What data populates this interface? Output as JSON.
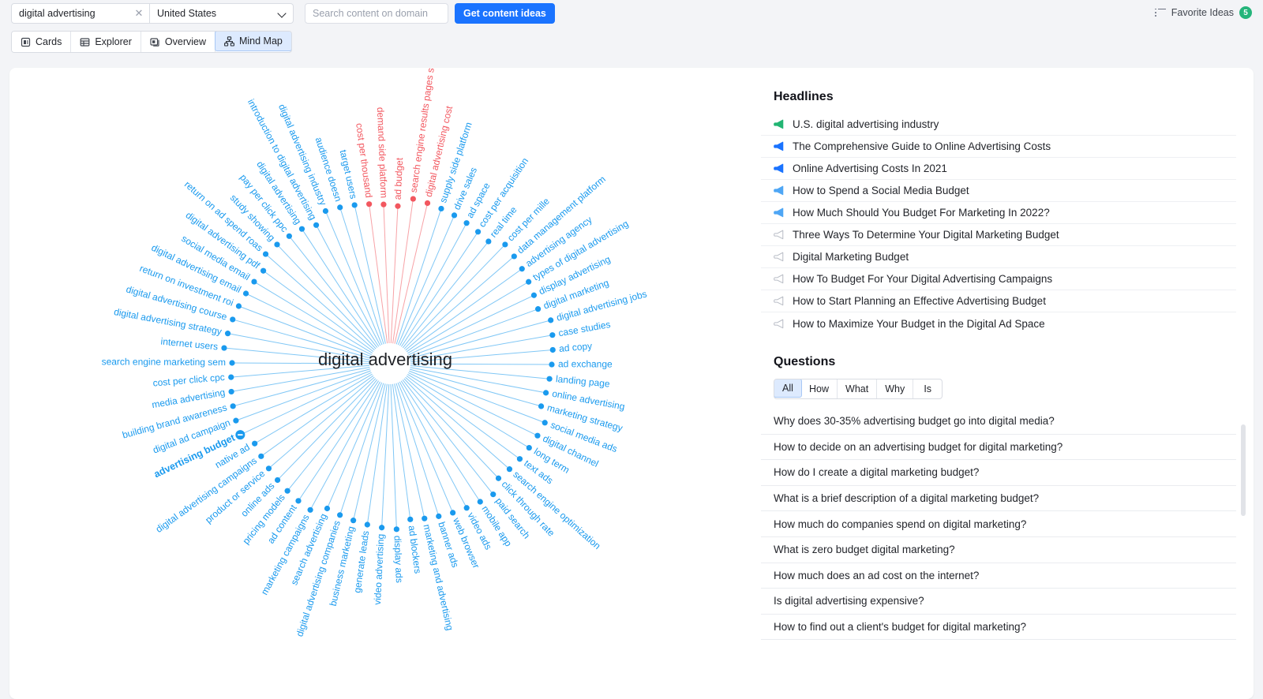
{
  "topbar": {
    "keyword": "digital advertising",
    "clear_icon": "close-icon",
    "location": "United States",
    "domain_placeholder": "Search content on domain",
    "domain_value": "",
    "cta_label": "Get content ideas",
    "favorites_label": "Favorite Ideas",
    "favorites_count": "5",
    "favorites_icon": "list-icon"
  },
  "tabs": [
    {
      "label": "Cards",
      "icon": "cards-icon",
      "active": false
    },
    {
      "label": "Explorer",
      "icon": "table-icon",
      "active": false
    },
    {
      "label": "Overview",
      "icon": "overview-icon",
      "active": false
    },
    {
      "label": "Mind Map",
      "icon": "mindmap-icon",
      "active": true
    }
  ],
  "mindmap": {
    "center": "digital advertising",
    "selected_node": "advertising budget",
    "colors": {
      "blue": "#1a9aee",
      "red": "#f2575f",
      "center_text": "#1f2126"
    },
    "nodes": [
      {
        "label": "introduction to digital advertising",
        "color": "blue"
      },
      {
        "label": "digital advertising industry",
        "color": "blue"
      },
      {
        "label": "audience doesn",
        "color": "blue"
      },
      {
        "label": "target users",
        "color": "blue"
      },
      {
        "label": "cost per thousand",
        "color": "red"
      },
      {
        "label": "demand side platform",
        "color": "red"
      },
      {
        "label": "ad budget",
        "color": "red"
      },
      {
        "label": "search engine results pages serps",
        "color": "red"
      },
      {
        "label": "digital advertising cost",
        "color": "red"
      },
      {
        "label": "supply side platform",
        "color": "blue"
      },
      {
        "label": "drive sales",
        "color": "blue"
      },
      {
        "label": "ad space",
        "color": "blue"
      },
      {
        "label": "cost per acquisition",
        "color": "blue"
      },
      {
        "label": "real time",
        "color": "blue"
      },
      {
        "label": "cost per mille",
        "color": "blue"
      },
      {
        "label": "data management platform",
        "color": "blue"
      },
      {
        "label": "advertising agency",
        "color": "blue"
      },
      {
        "label": "types of digital advertising",
        "color": "blue"
      },
      {
        "label": "display advertising",
        "color": "blue"
      },
      {
        "label": "digital marketing",
        "color": "blue"
      },
      {
        "label": "digital advertising jobs",
        "color": "blue"
      },
      {
        "label": "case studies",
        "color": "blue"
      },
      {
        "label": "ad copy",
        "color": "blue"
      },
      {
        "label": "ad exchange",
        "color": "blue"
      },
      {
        "label": "landing page",
        "color": "blue"
      },
      {
        "label": "online advertising",
        "color": "blue"
      },
      {
        "label": "marketing strategy",
        "color": "blue"
      },
      {
        "label": "social media ads",
        "color": "blue"
      },
      {
        "label": "digital channel",
        "color": "blue"
      },
      {
        "label": "long term",
        "color": "blue"
      },
      {
        "label": "text ads",
        "color": "blue"
      },
      {
        "label": "search engine optimization",
        "color": "blue"
      },
      {
        "label": "click through rate",
        "color": "blue"
      },
      {
        "label": "paid search",
        "color": "blue"
      },
      {
        "label": "mobile app",
        "color": "blue"
      },
      {
        "label": "video ads",
        "color": "blue"
      },
      {
        "label": "web browser",
        "color": "blue"
      },
      {
        "label": "banner ads",
        "color": "blue"
      },
      {
        "label": "marketing and advertising",
        "color": "blue"
      },
      {
        "label": "ad blockers",
        "color": "blue"
      },
      {
        "label": "display ads",
        "color": "blue"
      },
      {
        "label": "video advertising",
        "color": "blue"
      },
      {
        "label": "generate leads",
        "color": "blue"
      },
      {
        "label": "business marketing",
        "color": "blue"
      },
      {
        "label": "digital advertising companies",
        "color": "blue"
      },
      {
        "label": "search advertising",
        "color": "blue"
      },
      {
        "label": "marketing campaigns",
        "color": "blue"
      },
      {
        "label": "ad content",
        "color": "blue"
      },
      {
        "label": "pricing models",
        "color": "blue"
      },
      {
        "label": "online ads",
        "color": "blue"
      },
      {
        "label": "product or service",
        "color": "blue"
      },
      {
        "label": "digital advertising campaigns",
        "color": "blue"
      },
      {
        "label": "native ad",
        "color": "blue"
      },
      {
        "label": "advertising budget",
        "color": "blue",
        "selected": true
      },
      {
        "label": "digital ad campaign",
        "color": "blue"
      },
      {
        "label": "building brand awareness",
        "color": "blue"
      },
      {
        "label": "media advertising",
        "color": "blue"
      },
      {
        "label": "cost per click cpc",
        "color": "blue"
      },
      {
        "label": "search engine marketing sem",
        "color": "blue"
      },
      {
        "label": "internet users",
        "color": "blue"
      },
      {
        "label": "digital advertising strategy",
        "color": "blue"
      },
      {
        "label": "digital advertising course",
        "color": "blue"
      },
      {
        "label": "return on investment roi",
        "color": "blue"
      },
      {
        "label": "digital advertising email",
        "color": "blue"
      },
      {
        "label": "social media email",
        "color": "blue"
      },
      {
        "label": "digital advertising pdf",
        "color": "blue"
      },
      {
        "label": "return on ad spend roas",
        "color": "blue"
      },
      {
        "label": "study showing",
        "color": "blue"
      },
      {
        "label": "pay per click ppc",
        "color": "blue"
      },
      {
        "label": "digital advertising",
        "color": "blue"
      }
    ]
  },
  "headlines": {
    "title": "Headlines",
    "items": [
      {
        "text": "U.S. digital advertising industry",
        "icon": "megaphone-icon",
        "color": "#22b573"
      },
      {
        "text": "The Comprehensive Guide to Online Advertising Costs",
        "icon": "megaphone-icon",
        "color": "#1a73ff"
      },
      {
        "text": "Online Advertising Costs In 2021",
        "icon": "megaphone-icon",
        "color": "#1a73ff"
      },
      {
        "text": "How to Spend a Social Media Budget",
        "icon": "megaphone-icon",
        "color": "#4ea6f5"
      },
      {
        "text": "How Much Should You Budget For Marketing In 2022?",
        "icon": "megaphone-icon",
        "color": "#4ea6f5"
      },
      {
        "text": "Three Ways To Determine Your Digital Marketing Budget",
        "icon": "megaphone-icon",
        "color": "#b9bdc6"
      },
      {
        "text": "Digital Marketing Budget",
        "icon": "megaphone-icon",
        "color": "#b9bdc6"
      },
      {
        "text": "How To Budget For Your Digital Advertising Campaigns",
        "icon": "megaphone-icon",
        "color": "#b9bdc6"
      },
      {
        "text": "How to Start Planning an Effective Advertising Budget",
        "icon": "megaphone-icon",
        "color": "#b9bdc6"
      },
      {
        "text": "How to Maximize Your Budget in the Digital Ad Space",
        "icon": "megaphone-icon",
        "color": "#b9bdc6"
      }
    ]
  },
  "questions": {
    "title": "Questions",
    "filters": [
      {
        "label": "All",
        "active": true
      },
      {
        "label": "How",
        "active": false
      },
      {
        "label": "What",
        "active": false
      },
      {
        "label": "Why",
        "active": false
      },
      {
        "label": "Is",
        "active": false
      }
    ],
    "items": [
      "Why does 30-35% advertising budget go into digital media?",
      "How to decide on an advertising budget for digital marketing?",
      "How do I create a digital marketing budget?",
      "What is a brief description of a digital marketing budget?",
      "How much do companies spend on digital marketing?",
      "What is zero budget digital marketing?",
      "How much does an ad cost on the internet?",
      "Is digital advertising expensive?",
      "How to find out a client's budget for digital marketing?"
    ]
  }
}
